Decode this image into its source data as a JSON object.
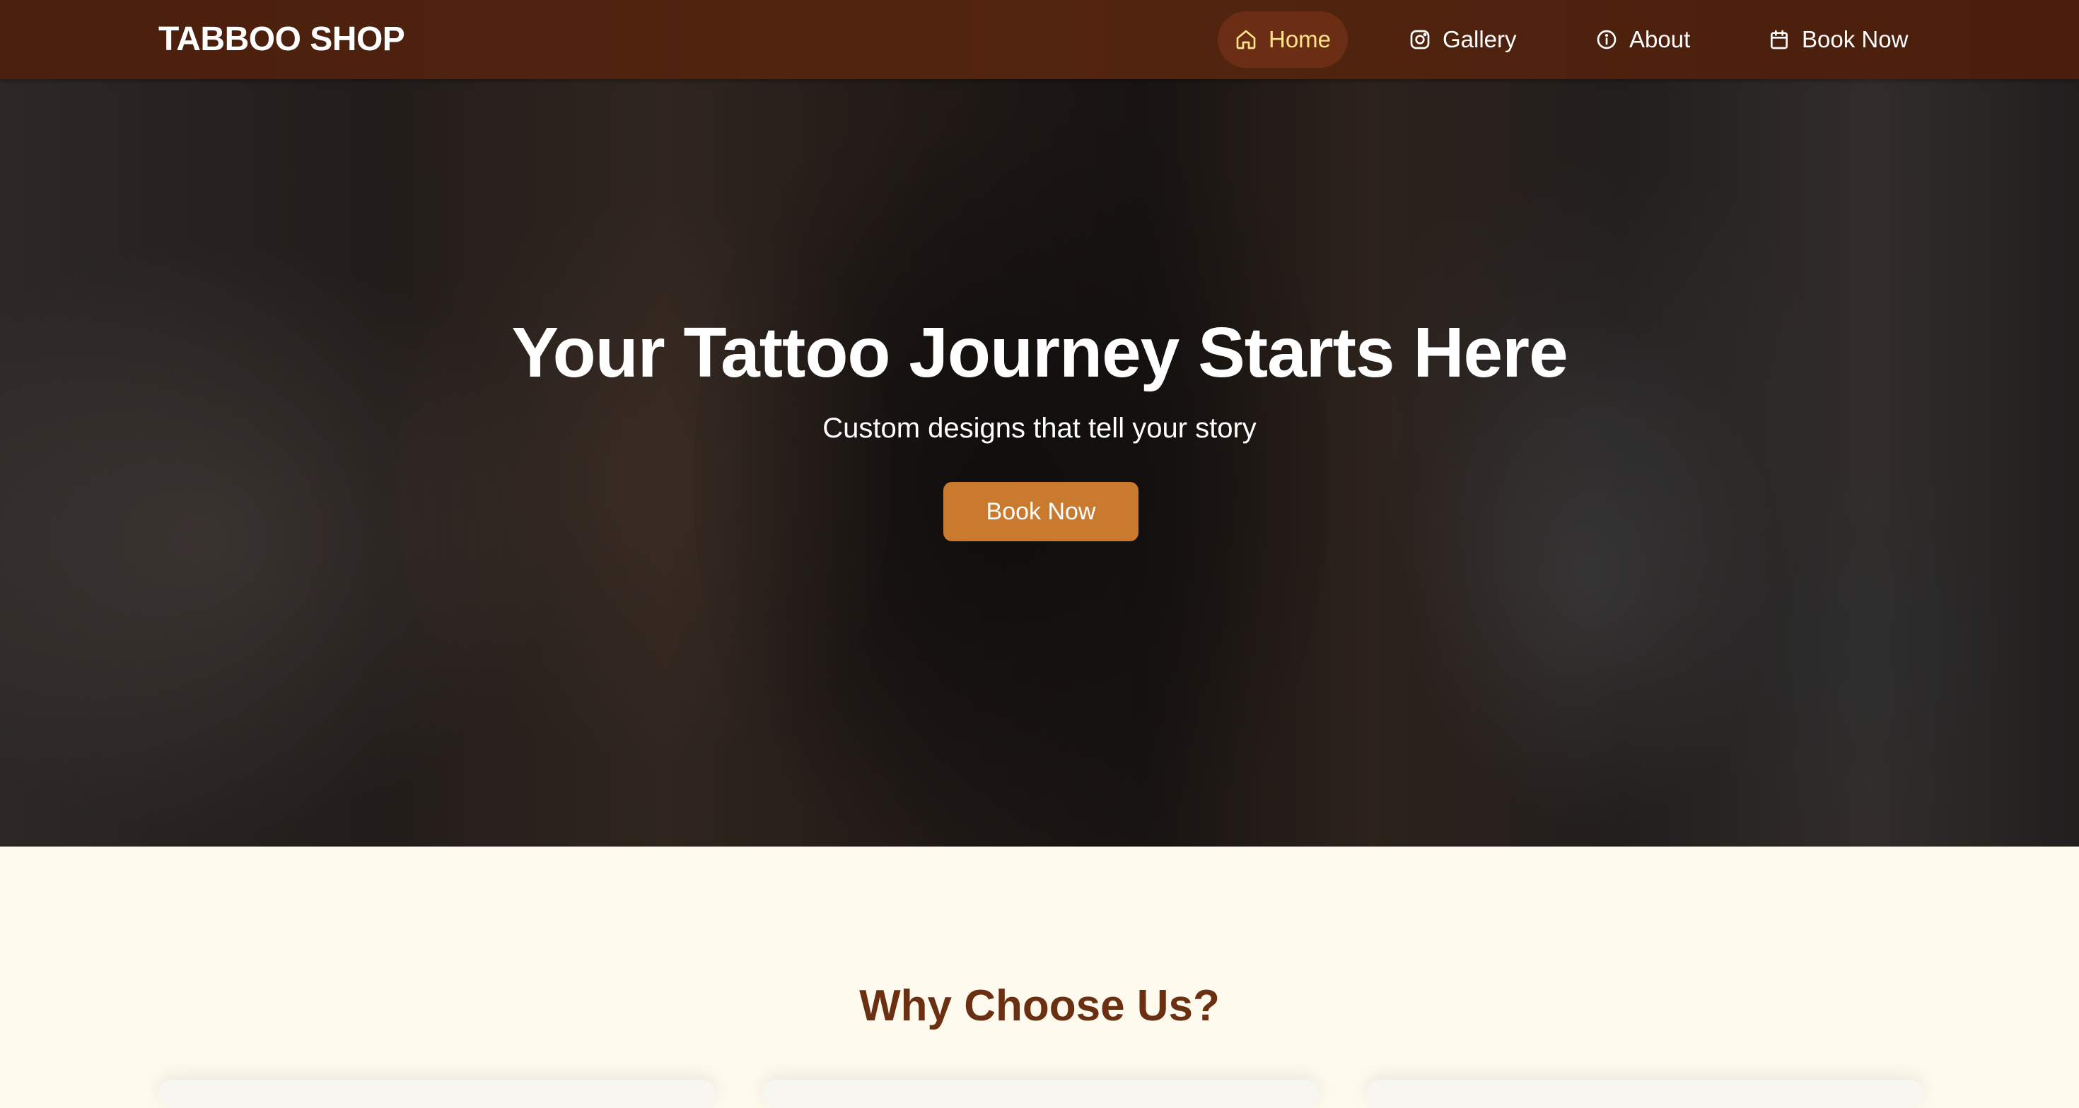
{
  "brand": "TABBOO SHOP",
  "nav": {
    "items": [
      {
        "label": "Home",
        "icon": "home-icon",
        "active": true
      },
      {
        "label": "Gallery",
        "icon": "instagram-icon",
        "active": false
      },
      {
        "label": "About",
        "icon": "info-icon",
        "active": false
      },
      {
        "label": "Book Now",
        "icon": "calendar-icon",
        "active": false
      }
    ]
  },
  "hero": {
    "title": "Your Tattoo Journey Starts Here",
    "subtitle": "Custom designs that tell your story",
    "cta": "Book Now"
  },
  "section": {
    "title": "Why Choose Us?"
  },
  "colors": {
    "nav_bg": "#4e220e",
    "active_pill": "#6b2d14",
    "active_text": "#fde38a",
    "cta": "#c97a2e",
    "section_bg": "#fefaee",
    "section_title": "#6b2f12"
  }
}
